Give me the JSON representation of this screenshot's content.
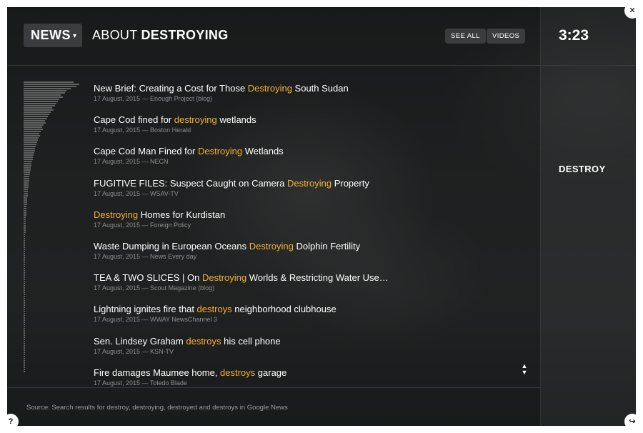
{
  "header": {
    "section_label": "NEWS",
    "about_prefix": "ABOUT",
    "about_word": "DESTROYING",
    "see_all_label": "SEE ALL",
    "videos_label": "VIDEOS"
  },
  "side": {
    "timer": "3:23",
    "word": "DESTROY"
  },
  "articles": [
    {
      "pre": "New Brief: Creating a Cost for Those ",
      "hl": "Destroying",
      "post": " South Sudan",
      "meta": "17 August, 2015 — Enough Project (blog)"
    },
    {
      "pre": "Cape Cod fined for ",
      "hl": "destroying",
      "post": " wetlands",
      "meta": "17 August, 2015 — Boston Herald"
    },
    {
      "pre": "Cape Cod Man Fined for ",
      "hl": "Destroying",
      "post": " Wetlands",
      "meta": "17 August, 2015 — NECN"
    },
    {
      "pre": "FUGITIVE FILES: Suspect Caught on Camera ",
      "hl": "Destroying",
      "post": " Property",
      "meta": "17 August, 2015 — WSAV-TV"
    },
    {
      "pre": "",
      "hl": "Destroying",
      "post": " Homes for Kurdistan",
      "meta": "17 August, 2015 — Foreign Policy"
    },
    {
      "pre": "Waste Dumping in European Oceans ",
      "hl": "Destroying",
      "post": " Dolphin Fertility",
      "meta": "17 August, 2015 — News Every day"
    },
    {
      "pre": "TEA & TWO SLICES | On ",
      "hl": "Destroying",
      "post": " Worlds & Restricting Water Use…",
      "meta": "17 August, 2015 — Scout Magazine (blog)"
    },
    {
      "pre": "Lightning ignites fire that ",
      "hl": "destroys",
      "post": " neighborhood clubhouse",
      "meta": "17 August, 2015 — WWAY NewsChannel 3"
    },
    {
      "pre": "Sen. Lindsey Graham ",
      "hl": "destroys",
      "post": " his cell phone",
      "meta": "17 August, 2015 — KSN-TV"
    },
    {
      "pre": "Fire damages Maumee home, ",
      "hl": "destroys",
      "post": " garage",
      "meta": "17 August, 2015 — Toledo Blade"
    }
  ],
  "footer": {
    "source": "Source: Search results for destroy, destroying, destroyed and destroys in Google News"
  },
  "controls": {
    "close_glyph": "✕",
    "help_glyph": "?",
    "share_glyph": "↪",
    "scroll_up_glyph": "▲",
    "scroll_down_glyph": "▼"
  },
  "colors": {
    "highlight": "#f2b233",
    "panel": "#1f2021"
  }
}
